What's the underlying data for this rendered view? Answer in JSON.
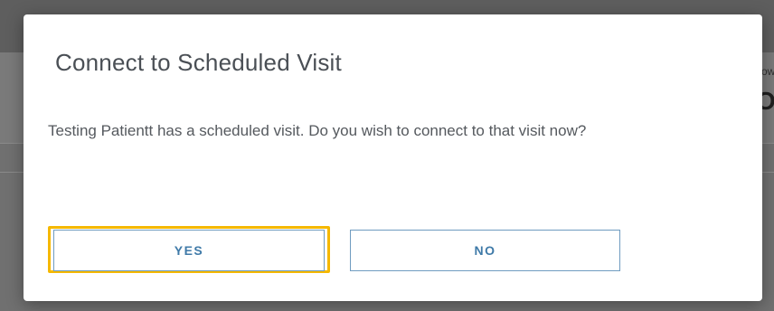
{
  "background": {
    "peek_small": "ow",
    "peek_large": "Or"
  },
  "dialog": {
    "title": "Connect to Scheduled Visit",
    "message": "Testing Patientt has a scheduled visit. Do you wish to connect to that visit now?",
    "yes_label": "YES",
    "no_label": "NO"
  },
  "colors": {
    "focus_ring": "#f5b800",
    "button_text": "#3f7aa8",
    "button_border": "#6f9cc0",
    "title_text": "#4a4f55",
    "overlay": "#707070"
  }
}
